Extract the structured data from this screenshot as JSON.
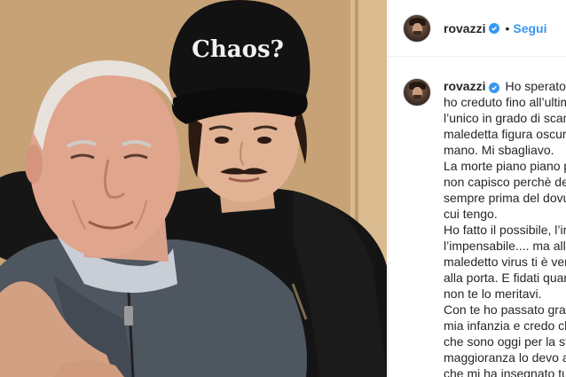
{
  "post": {
    "photo_cap_text": "Chaos?"
  },
  "header": {
    "username": "rovazzi",
    "separator": "•",
    "follow_label": "Segui"
  },
  "caption": {
    "username": "rovazzi",
    "lines": [
      "Ho sperato n",
      "ho creduto fino all’ultim",
      "l’unico in grado di scam",
      "maledetta figura oscura",
      "mano. Mi sbagliavo.",
      "La morte piano piano p",
      "non capisco perchè del",
      "sempre prima del dovu",
      "cui tengo.",
      "Ho fatto il possibile, l’im",
      "l’impensabile.... ma alla",
      "maledetto virus ti è ven",
      "alla porta. E fidati quan",
      "non te lo meritavi.",
      "Con te ho passato gran",
      "mia infanzia e credo ch",
      "che sono oggi per la st",
      "maggioranza lo devo a",
      "che mi ha insegnato tu"
    ]
  },
  "icons": {
    "verified": "verified-badge-icon"
  },
  "colors": {
    "accent": "#3897f0",
    "text": "#262626",
    "border": "#efefef"
  }
}
